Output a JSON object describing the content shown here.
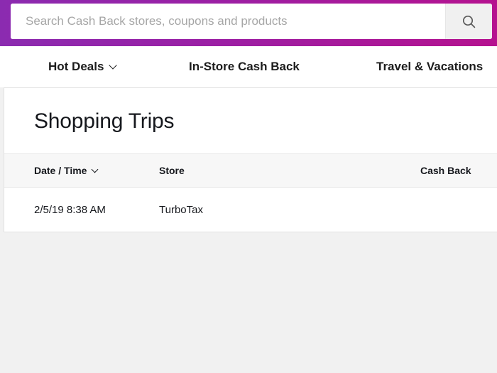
{
  "search": {
    "placeholder": "Search Cash Back stores, coupons and products",
    "value": "",
    "button_icon": "search-icon"
  },
  "nav": {
    "items": [
      {
        "label": "Hot Deals",
        "has_dropdown": true,
        "icon": "chevron-down-icon"
      },
      {
        "label": "In-Store Cash Back",
        "has_dropdown": false
      },
      {
        "label": "Travel & Vacations",
        "has_dropdown": false
      }
    ]
  },
  "main": {
    "title": "Shopping Trips",
    "table": {
      "columns": [
        {
          "label": "Date / Time",
          "sortable": true,
          "sort_icon": "chevron-down-icon"
        },
        {
          "label": "Store",
          "sortable": false
        },
        {
          "label": "Cash Back",
          "sortable": false
        }
      ],
      "rows": [
        {
          "date_time": "2/5/19 8:38 AM",
          "store": "TurboTax",
          "cash_back": ""
        }
      ]
    }
  },
  "colors": {
    "header_gradient_start": "#8b2bb0",
    "header_gradient_end": "#b5128f",
    "page_background": "#f1f1f1",
    "card_background": "#ffffff",
    "table_header_background": "#f7f7f7",
    "text_primary": "#16181d",
    "placeholder_text": "#a6a6a6"
  }
}
